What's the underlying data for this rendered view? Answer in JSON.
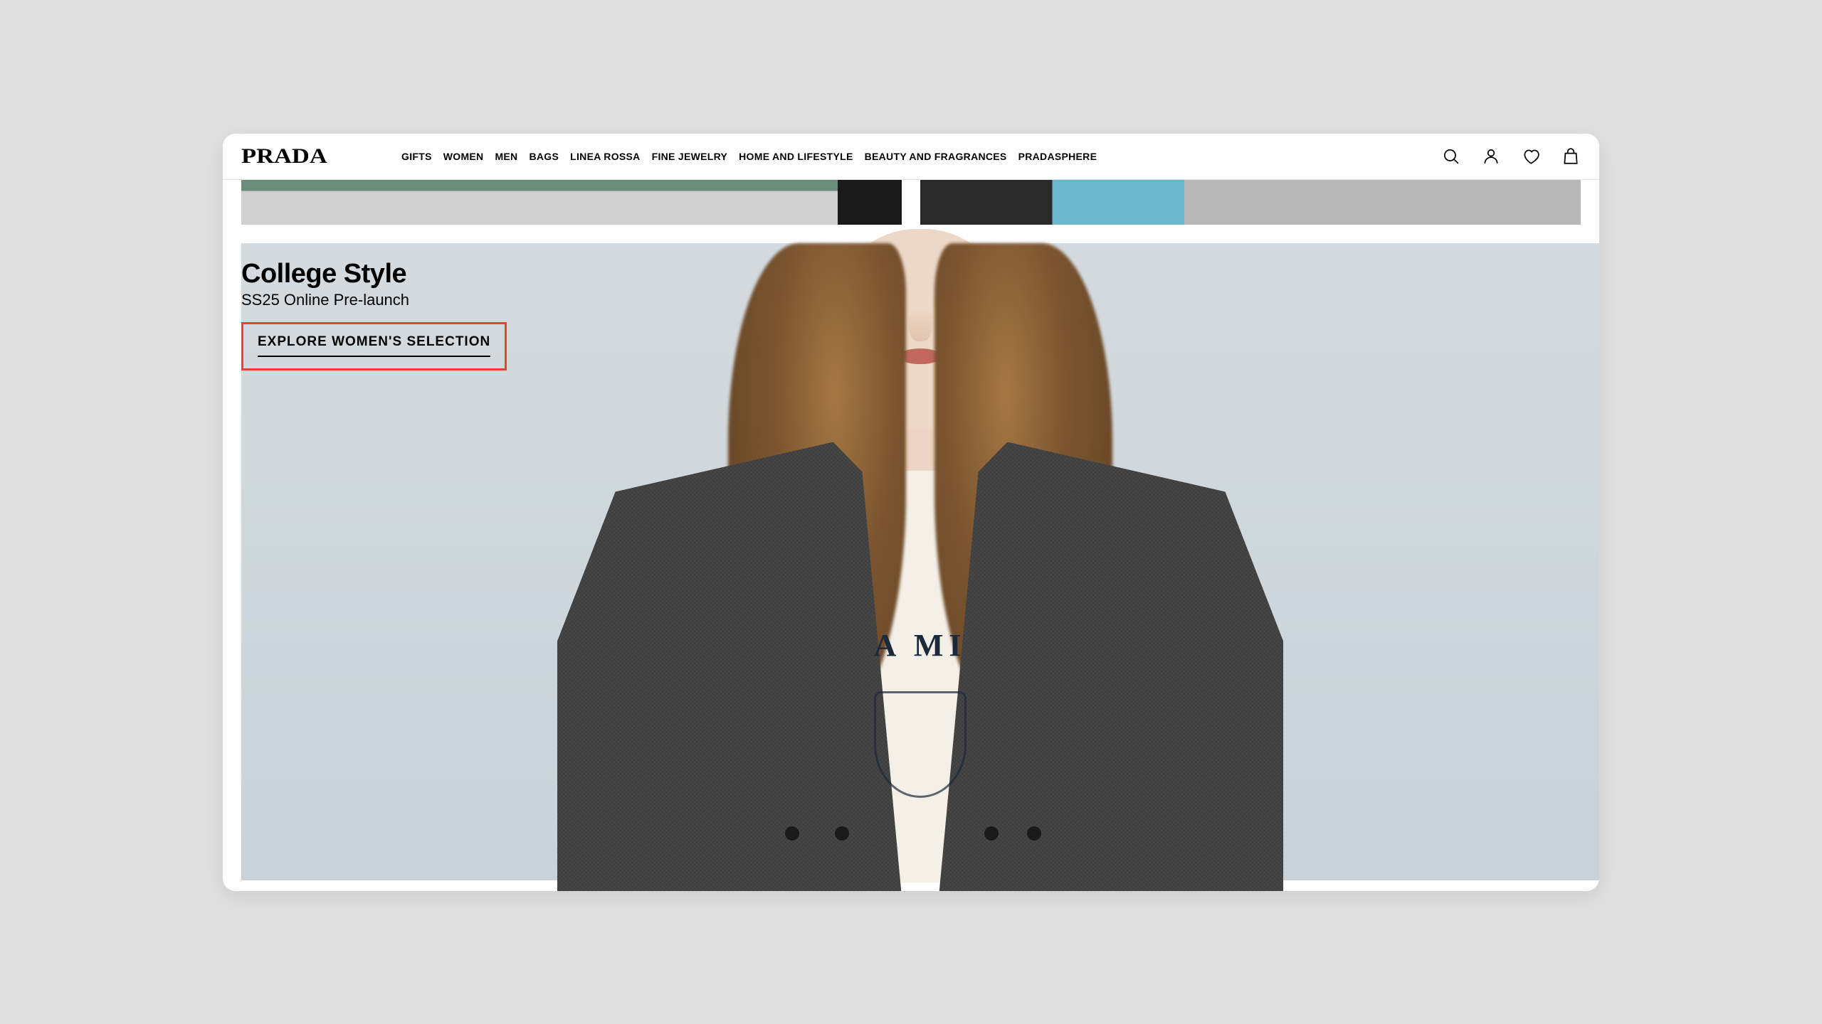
{
  "brand": "PRADA",
  "nav": {
    "items": [
      "GIFTS",
      "WOMEN",
      "MEN",
      "BAGS",
      "LINEA ROSSA",
      "FINE JEWELRY",
      "HOME AND LIFESTYLE",
      "BEAUTY AND FRAGRANCES",
      "PRADASPHERE"
    ]
  },
  "hero": {
    "title": "College Style",
    "subtitle": "SS25 Online Pre-launch",
    "cta": "EXPLORE WOMEN'S SELECTION",
    "shirt_text": "A MI"
  },
  "icons": {
    "search": "search-icon",
    "account": "account-icon",
    "wishlist": "wishlist-icon",
    "bag": "bag-icon"
  },
  "highlight_color": "#e9432e"
}
